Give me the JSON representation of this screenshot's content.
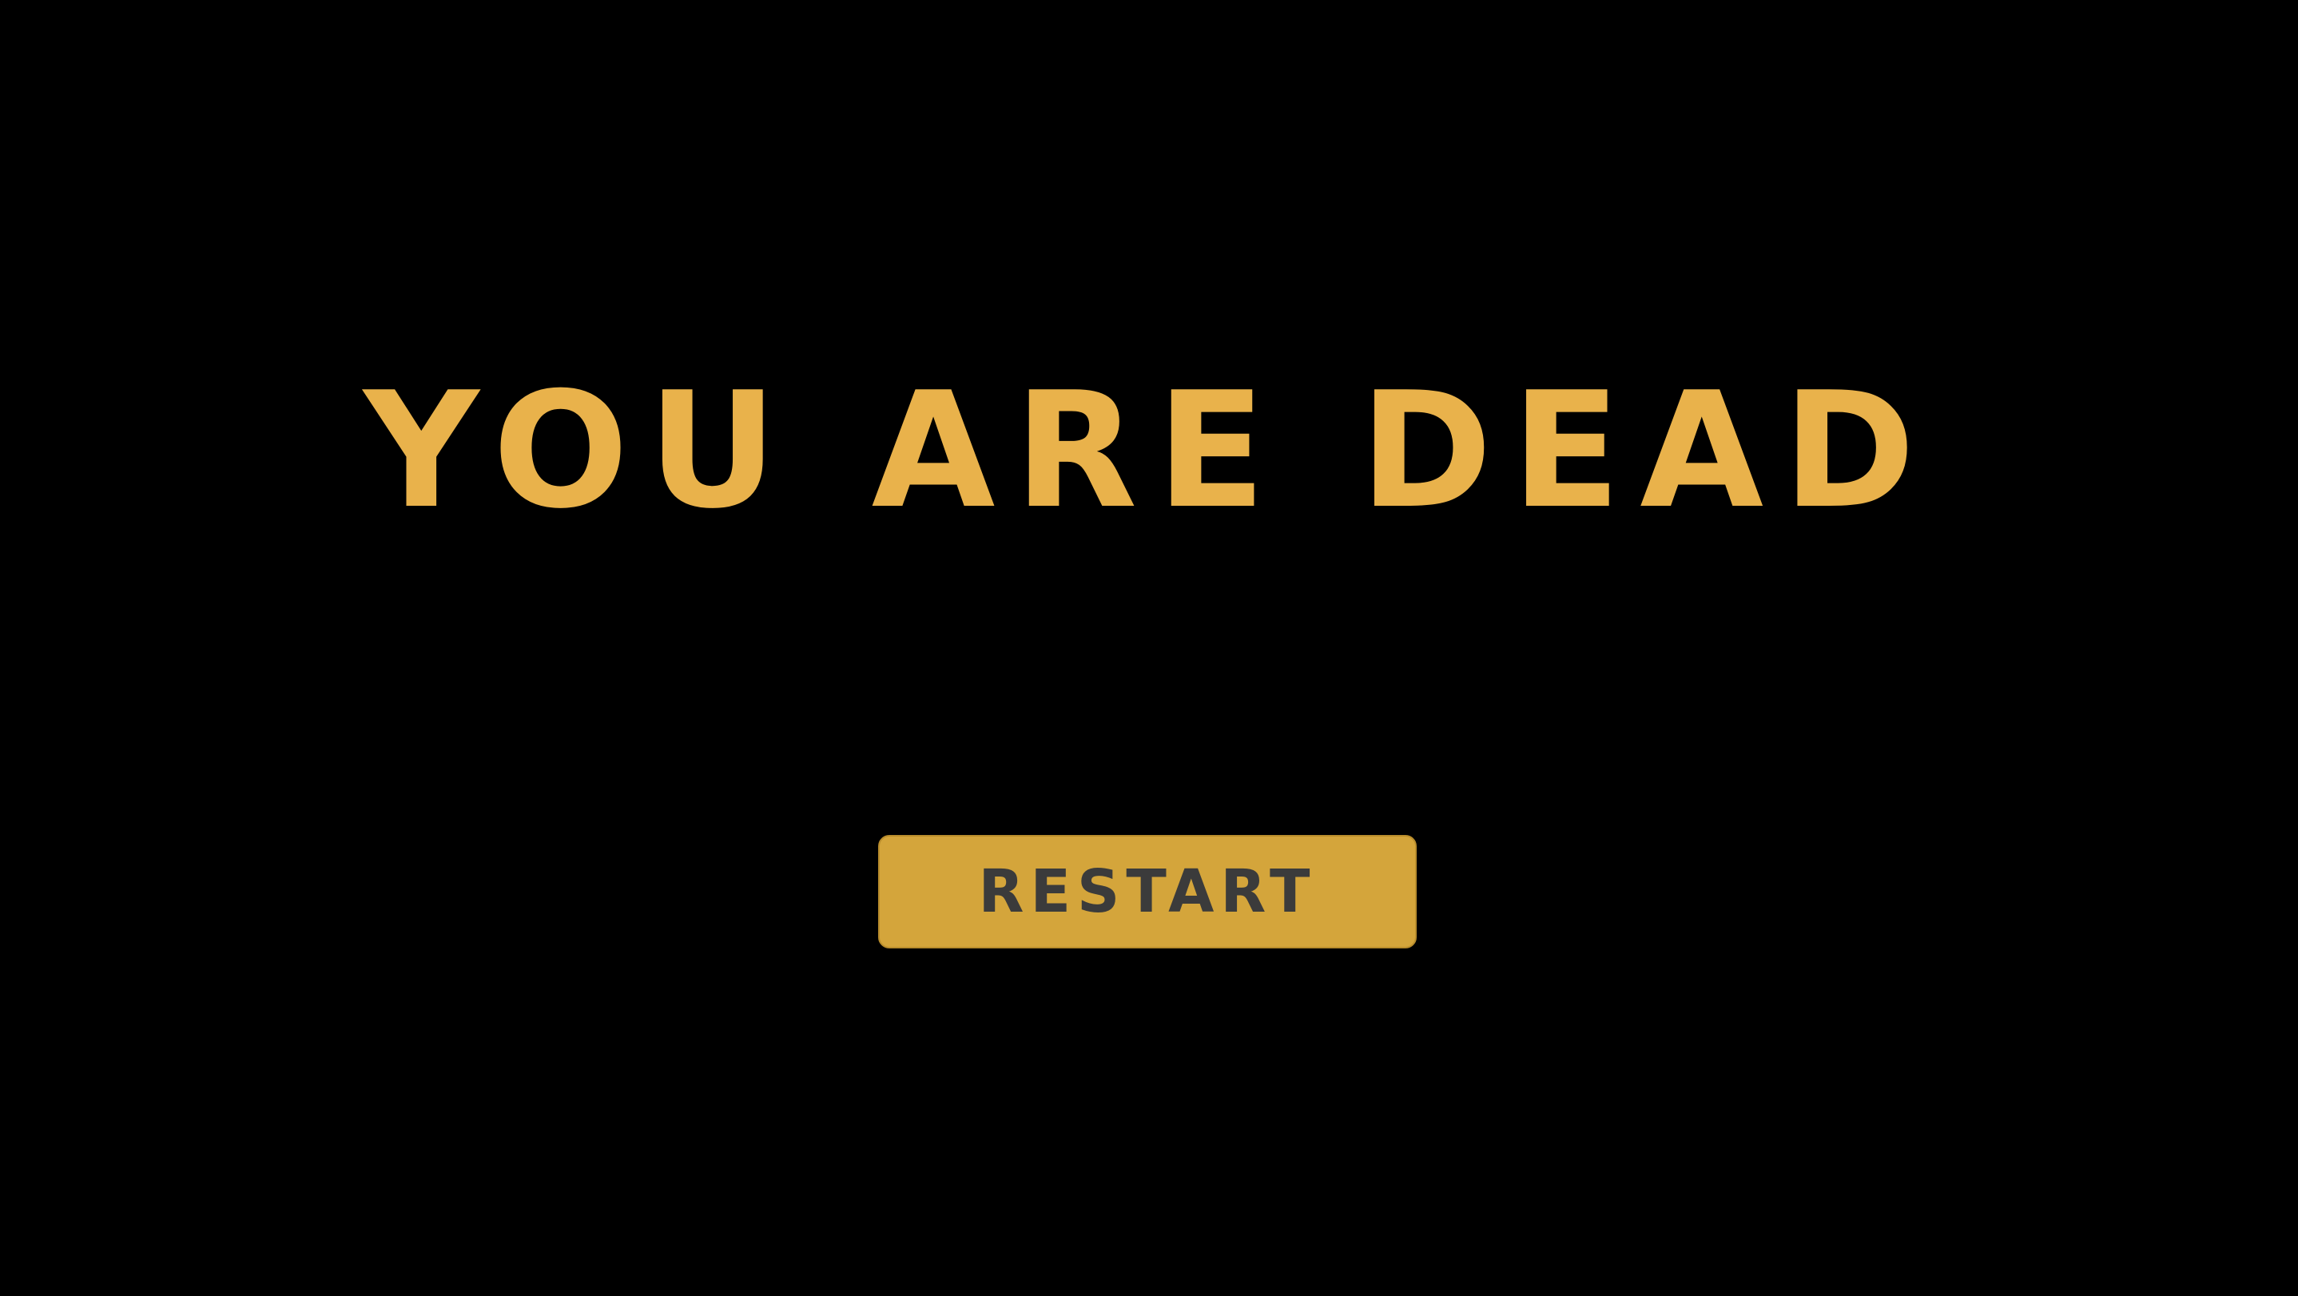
{
  "game_over": {
    "title": "YOU ARE DEAD",
    "restart_label": "RESTART"
  },
  "colors": {
    "background": "#000000",
    "title_text": "#e9b24b",
    "button_background": "#d4a53b",
    "button_text": "#3b3b3b"
  }
}
